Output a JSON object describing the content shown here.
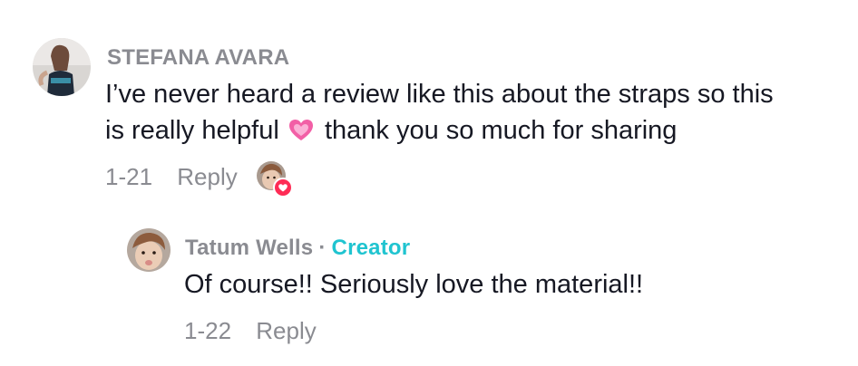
{
  "comments": [
    {
      "username": "STEFANA AVARA",
      "text_line1": "I’ve never heard a review like this about the straps so this",
      "text_line2_before": "is really helpful",
      "emoji": "💗",
      "text_line2_after": "thank you so much for sharing",
      "date": "1-21",
      "reply_label": "Reply"
    },
    {
      "username": "Tatum Wells",
      "separator": "·",
      "creator_badge": "Creator",
      "text": "Of course!! Seriously love the material!!",
      "date": "1-22",
      "reply_label": "Reply"
    }
  ],
  "colors": {
    "username": "#8a8b91",
    "text": "#161823",
    "creator": "#20c4d0",
    "like_badge": "#fe2c55"
  },
  "icons": {
    "liked_by_creator": "heart-icon",
    "emoji": "pink-heart-emoji"
  }
}
